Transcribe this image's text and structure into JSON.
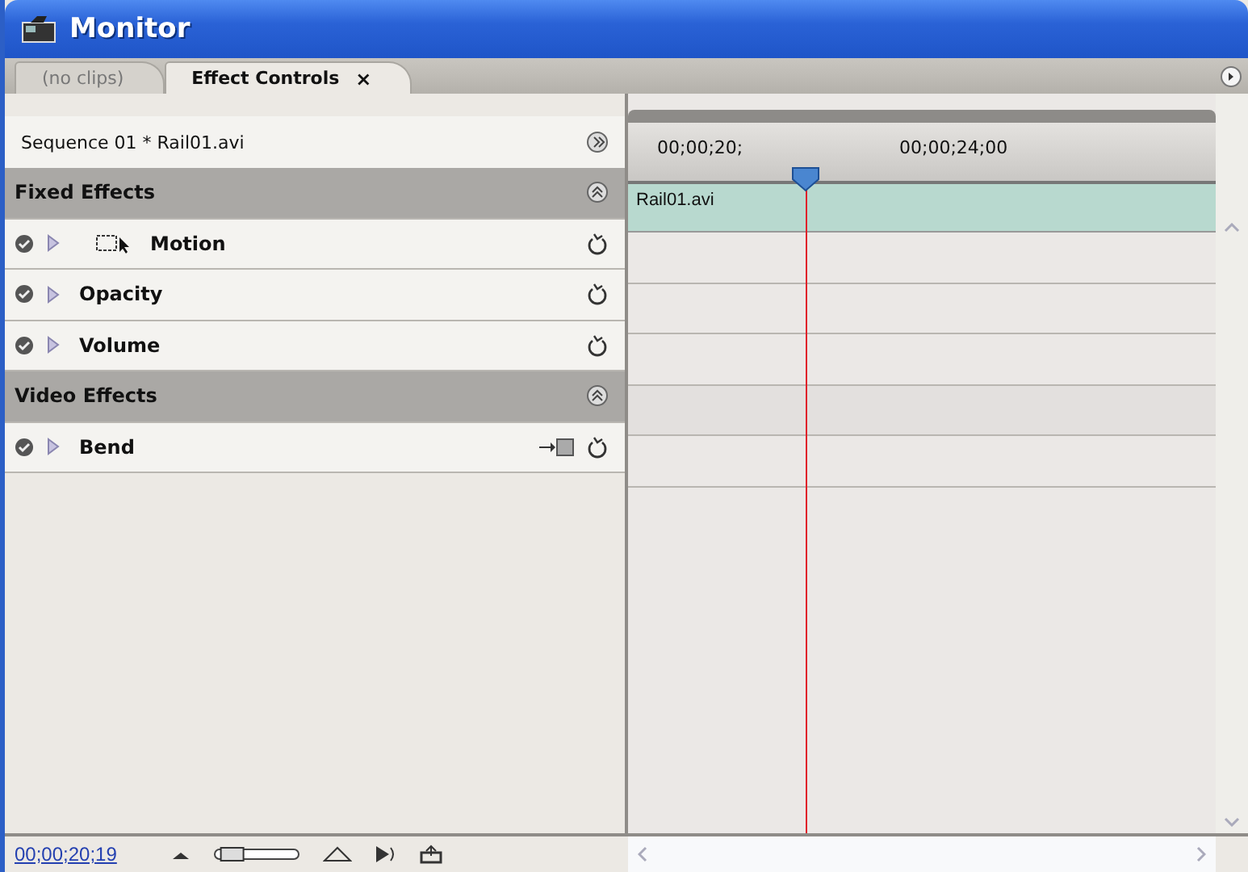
{
  "window": {
    "title": "Monitor"
  },
  "tabs": [
    {
      "label": "(no clips)",
      "selected": false
    },
    {
      "label": "Effect Controls",
      "selected": true,
      "close": "×"
    }
  ],
  "header": {
    "clip": "Sequence 01 * Rail01.avi"
  },
  "ruler": {
    "ticks": [
      "00;00;20;",
      "00;00;24;00"
    ]
  },
  "clip_bar": {
    "label": "Rail01.avi"
  },
  "effects": [
    {
      "kind": "section",
      "label": "Fixed Effects"
    },
    {
      "kind": "motion-effect",
      "label": "Motion"
    },
    {
      "kind": "effect",
      "label": "Opacity"
    },
    {
      "kind": "effect",
      "label": "Volume"
    },
    {
      "kind": "section",
      "label": "Video Effects"
    },
    {
      "kind": "keyframed-effect",
      "label": "Bend"
    }
  ],
  "status": {
    "timecode": "00;00;20;19",
    "zoom": {
      "level": 0.1
    }
  }
}
